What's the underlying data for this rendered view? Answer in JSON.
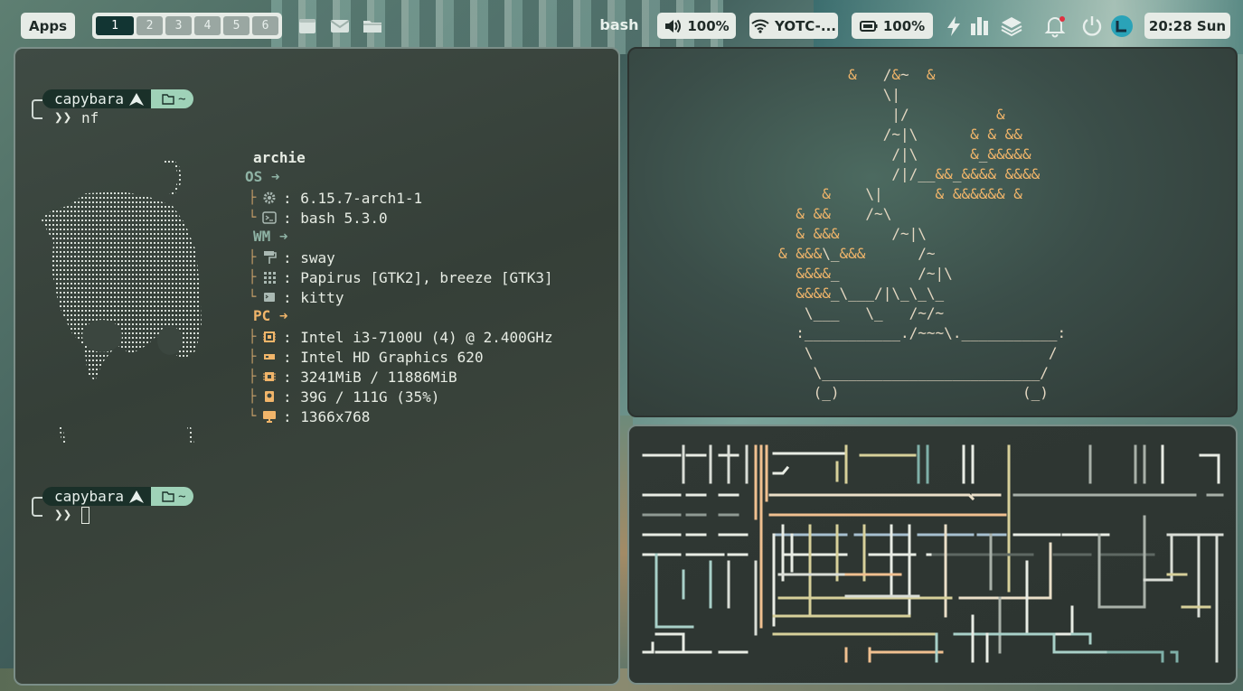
{
  "topbar": {
    "apps_label": "Apps",
    "workspaces": [
      "1",
      "2",
      "3",
      "4",
      "5",
      "6"
    ],
    "active_workspace": "1",
    "focused_title": "bash",
    "volume": "100%",
    "wifi": "YOTC-...",
    "battery": "100%",
    "clock": "20:28 Sun",
    "launchers": [
      "browser-icon",
      "mail-icon",
      "folder-icon"
    ],
    "tray_icons": [
      "bolt-icon",
      "bars-icon",
      "layers-icon",
      "bell-icon",
      "power-icon",
      "avatar"
    ],
    "notification_color": "#e03040"
  },
  "terminal": {
    "prompt_user": "capybara",
    "prompt_dir": "~",
    "command": "nf",
    "hostname": "archie",
    "sections": {
      "os": "OS",
      "wm": "WM",
      "pc": "PC"
    },
    "os_rows": [
      {
        "icon": "gear-icon",
        "value": "6.15.7-arch1-1"
      },
      {
        "icon": "terminal-icon",
        "value": "bash 5.3.0"
      }
    ],
    "wm_rows": [
      {
        "icon": "paint-roller-icon",
        "value": "sway"
      },
      {
        "icon": "grid-icon",
        "value": "Papirus [GTK2], breeze [GTK3]"
      },
      {
        "icon": "window-icon",
        "value": "kitty"
      }
    ],
    "pc_rows": [
      {
        "icon": "cpu-icon",
        "value": "Intel i3-7100U (4) @ 2.400GHz"
      },
      {
        "icon": "gpu-icon",
        "value": "Intel HD Graphics 620"
      },
      {
        "icon": "memory-icon",
        "value": "3241MiB / 11886MiB"
      },
      {
        "icon": "disk-icon",
        "value": "39G / 111G (35%)"
      },
      {
        "icon": "monitor-icon",
        "value": "1366x768"
      }
    ],
    "separator": ":",
    "prompt_chevron": "❯❯"
  },
  "bonsai_lines": [
    "        &   /&~  &",
    "            \\|",
    "             |/          &",
    "            /~|\\      & & &&",
    "             /|\\      &_&&&&&",
    "             /|/__&&_&&&& &&&&",
    "     &    \\|      & &&&&&& &",
    "  & &&    /~\\",
    "  & &&&      /~|\\",
    "& &&&\\_&&&      /~",
    "  &&&&_         /~|\\",
    "  &&&&_\\___/|\\_\\_\\_",
    "   \\___   \\_   /~/~",
    "  :___________./~~~\\.___________:",
    "   \\                           /",
    "    \\_________________________/",
    "    (_)                     (_)"
  ],
  "colors": {
    "accent": "#9fd2b8",
    "prompt_dark": "#1a3029",
    "bonsai_leaf": "#f1b56a",
    "bonsai_trunk": "#e4d7c1"
  }
}
